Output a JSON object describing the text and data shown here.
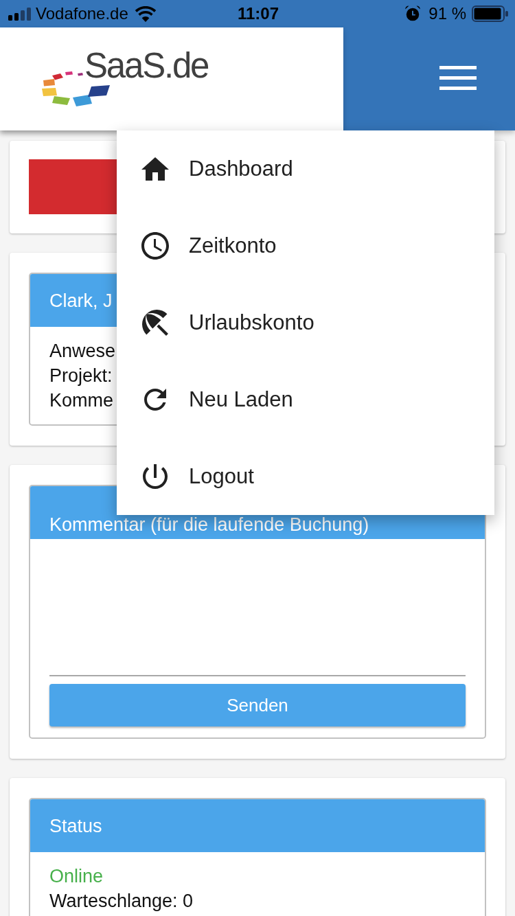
{
  "status_bar": {
    "carrier": "Vodafone.de",
    "time": "11:07",
    "battery": "91 %"
  },
  "header": {
    "logo": "SaaS.de"
  },
  "menu": {
    "items": [
      {
        "kind": "home",
        "label": "Dashboard"
      },
      {
        "kind": "clock",
        "label": "Zeitkonto"
      },
      {
        "kind": "umbrella",
        "label": "Urlaubskonto"
      },
      {
        "kind": "reload",
        "label": "Neu Laden"
      },
      {
        "kind": "power",
        "label": "Logout"
      }
    ]
  },
  "employee": {
    "title": "Clark, J",
    "lines": [
      "Anwese",
      "Projekt:",
      "Komme"
    ]
  },
  "comment": {
    "title": "Kommentar (für die laufende Buchung)",
    "button": "Senden"
  },
  "status": {
    "title": "Status",
    "connection": "Online",
    "queue": "Warteschlange: 0"
  }
}
